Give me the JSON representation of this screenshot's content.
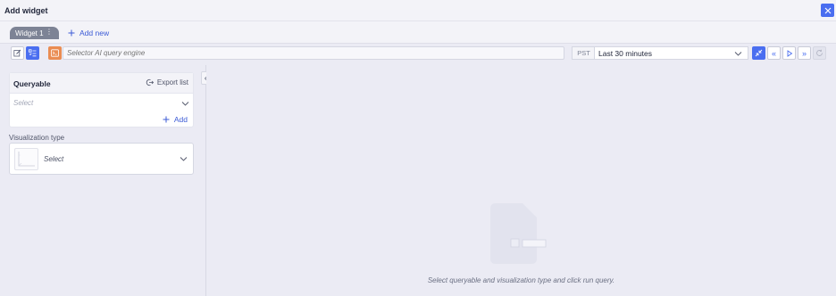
{
  "window": {
    "title": "Add widget",
    "close_icon": "close-icon"
  },
  "tabs": {
    "items": [
      {
        "label": "Widget 1",
        "menu_icon": "kebab-icon"
      }
    ],
    "add_new_label": "Add new"
  },
  "toolbar": {
    "query_placeholder": "Selector AI query engine",
    "query_value": "",
    "timezone": "PST",
    "time_range": "Last 30 minutes",
    "accent_color": "#4a6ef0",
    "ai_color": "#ea8c52"
  },
  "queryable": {
    "title": "Queryable",
    "export_label": "Export list",
    "select_placeholder": "Select",
    "add_label": "Add"
  },
  "visualization": {
    "label": "Visualization type",
    "select_placeholder": "Select"
  },
  "empty_state": {
    "message": "Select queryable and visualization type and click run query."
  }
}
